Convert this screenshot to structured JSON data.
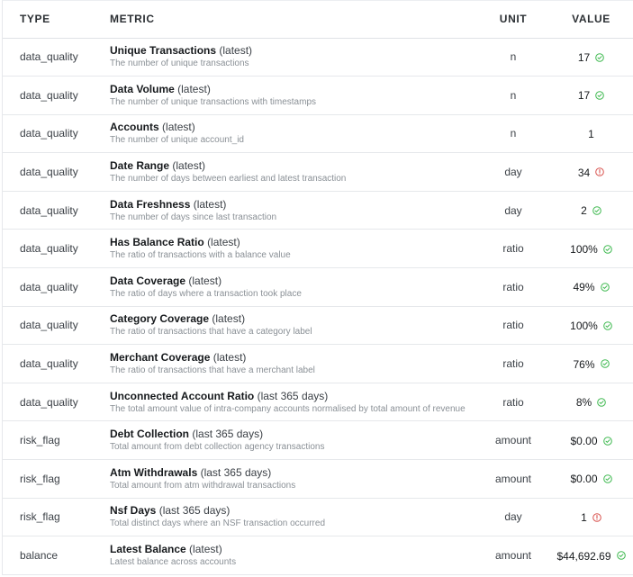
{
  "header": {
    "type": "TYPE",
    "metric": "METRIC",
    "unit": "UNIT",
    "value": "VALUE"
  },
  "colors": {
    "ok": "#3fb950",
    "warn": "#d9534f"
  },
  "rows": [
    {
      "type": "data_quality",
      "name": "Unique Transactions",
      "period": "(latest)",
      "desc": "The number of unique transactions",
      "unit": "n",
      "value": "17",
      "status": "ok",
      "status_icon": "check-circle-icon"
    },
    {
      "type": "data_quality",
      "name": "Data Volume",
      "period": "(latest)",
      "desc": "The number of unique transactions with timestamps",
      "unit": "n",
      "value": "17",
      "status": "ok",
      "status_icon": "check-circle-icon"
    },
    {
      "type": "data_quality",
      "name": "Accounts",
      "period": "(latest)",
      "desc": "The number of unique account_id",
      "unit": "n",
      "value": "1",
      "status": "none",
      "status_icon": ""
    },
    {
      "type": "data_quality",
      "name": "Date Range",
      "period": "(latest)",
      "desc": "The number of days between earliest and latest transaction",
      "unit": "day",
      "value": "34",
      "status": "warn",
      "status_icon": "alert-circle-icon"
    },
    {
      "type": "data_quality",
      "name": "Data Freshness",
      "period": "(latest)",
      "desc": "The number of days since last transaction",
      "unit": "day",
      "value": "2",
      "status": "ok",
      "status_icon": "check-circle-icon"
    },
    {
      "type": "data_quality",
      "name": "Has Balance Ratio",
      "period": "(latest)",
      "desc": "The ratio of transactions with a balance value",
      "unit": "ratio",
      "value": "100%",
      "status": "ok",
      "status_icon": "check-circle-icon"
    },
    {
      "type": "data_quality",
      "name": "Data Coverage",
      "period": "(latest)",
      "desc": "The ratio of days where a transaction took place",
      "unit": "ratio",
      "value": "49%",
      "status": "ok",
      "status_icon": "check-circle-icon"
    },
    {
      "type": "data_quality",
      "name": "Category Coverage",
      "period": "(latest)",
      "desc": "The ratio of transactions that have a category label",
      "unit": "ratio",
      "value": "100%",
      "status": "ok",
      "status_icon": "check-circle-icon"
    },
    {
      "type": "data_quality",
      "name": "Merchant Coverage",
      "period": "(latest)",
      "desc": "The ratio of transactions that have a merchant label",
      "unit": "ratio",
      "value": "76%",
      "status": "ok",
      "status_icon": "check-circle-icon"
    },
    {
      "type": "data_quality",
      "name": "Unconnected Account Ratio",
      "period": "(last 365 days)",
      "desc": "The total amount value of intra-company accounts normalised by total amount of revenue",
      "unit": "ratio",
      "value": "8%",
      "status": "ok",
      "status_icon": "check-circle-icon"
    },
    {
      "type": "risk_flag",
      "name": "Debt Collection",
      "period": "(last 365 days)",
      "desc": "Total amount from debt collection agency transactions",
      "unit": "amount",
      "value": "$0.00",
      "status": "ok",
      "status_icon": "check-circle-icon"
    },
    {
      "type": "risk_flag",
      "name": "Atm Withdrawals",
      "period": "(last 365 days)",
      "desc": "Total amount from atm withdrawal transactions",
      "unit": "amount",
      "value": "$0.00",
      "status": "ok",
      "status_icon": "check-circle-icon"
    },
    {
      "type": "risk_flag",
      "name": "Nsf Days",
      "period": "(last 365 days)",
      "desc": "Total distinct days where an NSF transaction occurred",
      "unit": "day",
      "value": "1",
      "status": "warn",
      "status_icon": "alert-circle-icon"
    },
    {
      "type": "balance",
      "name": "Latest Balance",
      "period": "(latest)",
      "desc": "Latest balance across accounts",
      "unit": "amount",
      "value": "$44,692.69",
      "status": "ok",
      "status_icon": "check-circle-icon"
    }
  ]
}
